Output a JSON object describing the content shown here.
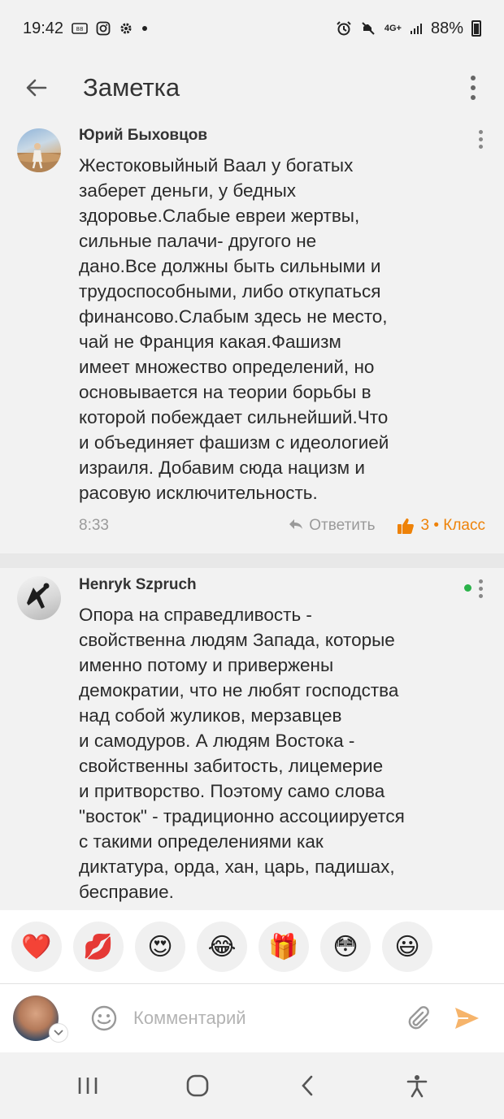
{
  "status_bar": {
    "time": "19:42",
    "battery_percent": "88%",
    "network": "4G+"
  },
  "app_bar": {
    "title": "Заметка"
  },
  "comments": [
    {
      "author": "Юрий Быховцов",
      "text": "Жестоковыйный Ваал у богатых\nзаберет деньги, у бедных\nздоровье.Слабые евреи жертвы,\nсильные палачи- другого не\nдано.Все должны быть сильными и\nтрудоспособными, либо откупаться\nфинансово.Слабым здесь не место,\nчай не Франция какая.Фашизм\nимеет множество определений, но\nосновывается на теории борьбы в\nкоторой побеждает сильнейший.Что\nи объединяет фашизм с идеологией\nизраиля. Добавим сюда  нацизм и\nрасовую исключительность.",
      "time": "8:33",
      "reply_label": "Ответить",
      "likes_label": "3 • Класс"
    },
    {
      "author": "Henryk Szpruch",
      "online": true,
      "text": "Опора на справедливость -\nсвойственна людям Запада, которые\nименно потому и привержены\nдемократии, что не любят господства\nнад собой жуликов, мерзавцев\nи самодуров. А людям Востока -\nсвойственны забитость, лицемерие\nи притворство. Поэтому само слова\n\"восток\" - традиционно ассоциируется\nс такими определениями как\nдиктатура, орда, хан, царь, падишах,\nбесправие."
    }
  ],
  "reactions": [
    {
      "name": "heart",
      "glyph": "❤️"
    },
    {
      "name": "kiss",
      "glyph": "💋"
    },
    {
      "name": "heart-eyes",
      "glyph": "😍"
    },
    {
      "name": "laughing",
      "glyph": "😂"
    },
    {
      "name": "gift",
      "glyph": "🎁"
    },
    {
      "name": "flushed",
      "glyph": "😳"
    },
    {
      "name": "smiley",
      "glyph": "😃"
    }
  ],
  "composer": {
    "placeholder": "Комментарий"
  },
  "colors": {
    "accent": "#ee8208",
    "online": "#2bb34a",
    "background": "#f2f2f2"
  }
}
